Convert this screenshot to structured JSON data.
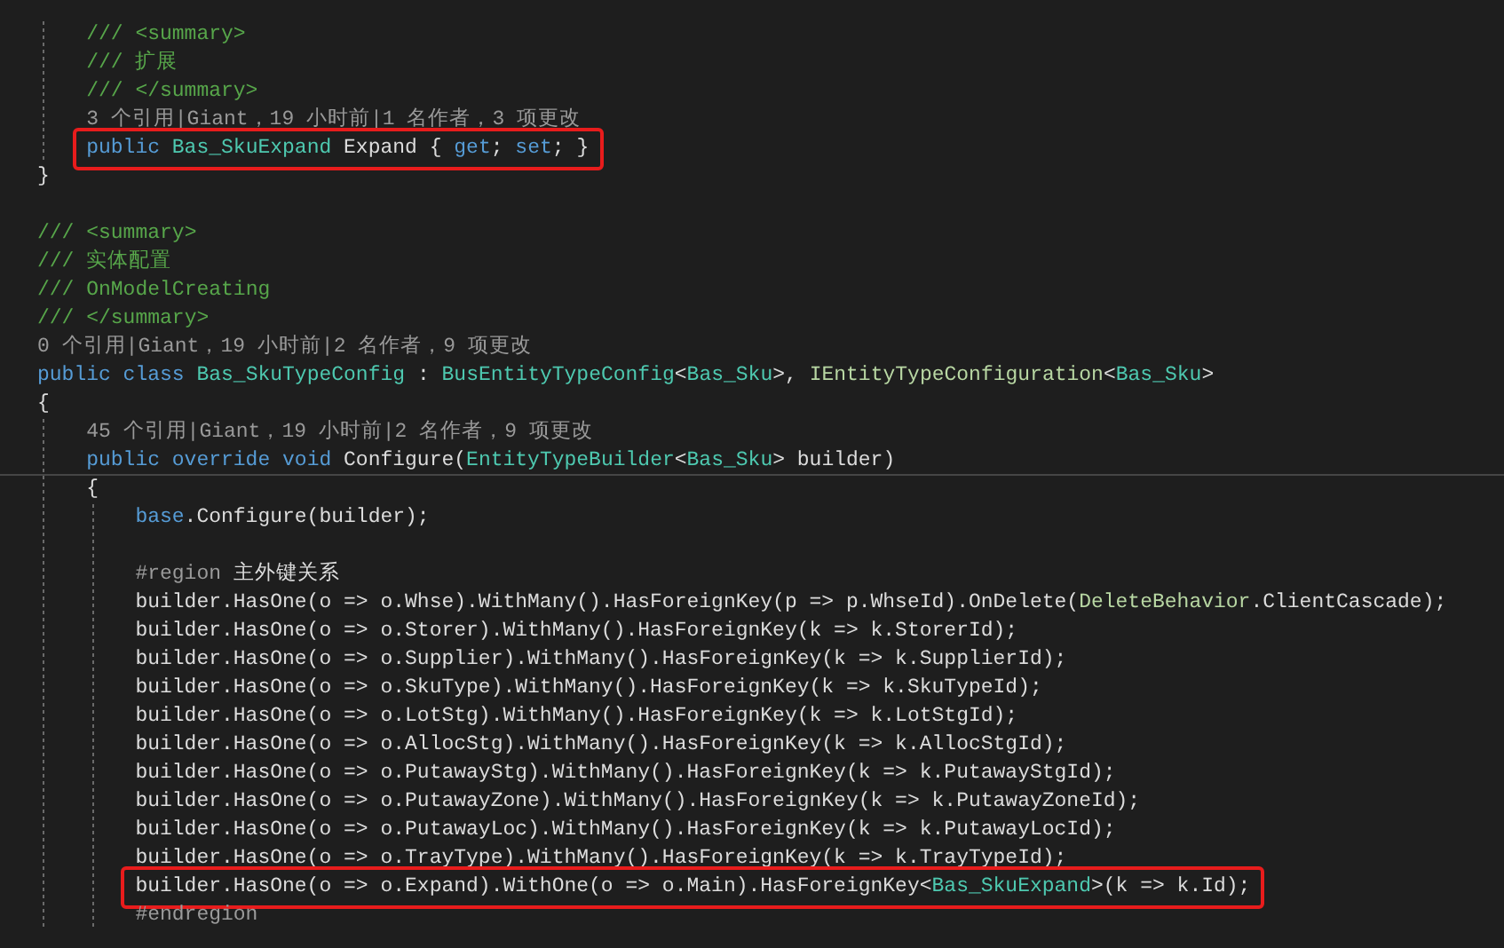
{
  "editor": {
    "lines": [
      {
        "kind": "comment",
        "tokens": [
          {
            "kind": "comment",
            "text": "    /// <summary>"
          }
        ]
      },
      {
        "kind": "comment",
        "tokens": [
          {
            "kind": "comment",
            "text": "    /// 扩展"
          }
        ]
      },
      {
        "kind": "comment",
        "tokens": [
          {
            "kind": "comment",
            "text": "    /// </summary>"
          }
        ]
      },
      {
        "kind": "codelens",
        "tokens": [
          {
            "kind": "codelens",
            "text": "    3 个引用|Giant，19 小时前|1 名作者，3 项更改"
          }
        ]
      },
      {
        "kind": "code",
        "highlighted": true,
        "tokens": [
          {
            "kind": "keyword",
            "text": "    public "
          },
          {
            "kind": "type",
            "text": "Bas_SkuExpand"
          },
          {
            "kind": "plain",
            "text": " Expand { "
          },
          {
            "kind": "keyword",
            "text": "get"
          },
          {
            "kind": "plain",
            "text": "; "
          },
          {
            "kind": "keyword",
            "text": "set"
          },
          {
            "kind": "plain",
            "text": "; }"
          }
        ]
      },
      {
        "kind": "code",
        "tokens": [
          {
            "kind": "plain",
            "text": "}"
          }
        ]
      },
      {
        "kind": "blank"
      },
      {
        "kind": "comment",
        "tokens": [
          {
            "kind": "comment",
            "text": "/// <summary>"
          }
        ]
      },
      {
        "kind": "comment",
        "tokens": [
          {
            "kind": "comment",
            "text": "/// 实体配置"
          }
        ]
      },
      {
        "kind": "comment",
        "tokens": [
          {
            "kind": "comment",
            "text": "/// OnModelCreating"
          }
        ]
      },
      {
        "kind": "comment",
        "tokens": [
          {
            "kind": "comment",
            "text": "/// </summary>"
          }
        ]
      },
      {
        "kind": "codelens",
        "tokens": [
          {
            "kind": "codelens",
            "text": "0 个引用|Giant，19 小时前|2 名作者，9 项更改"
          }
        ]
      },
      {
        "kind": "code",
        "tokens": [
          {
            "kind": "keyword",
            "text": "public class "
          },
          {
            "kind": "type",
            "text": "Bas_SkuTypeConfig"
          },
          {
            "kind": "plain",
            "text": " : "
          },
          {
            "kind": "type",
            "text": "BusEntityTypeConfig"
          },
          {
            "kind": "plain",
            "text": "<"
          },
          {
            "kind": "type",
            "text": "Bas_Sku"
          },
          {
            "kind": "plain",
            "text": ">, "
          },
          {
            "kind": "interface",
            "text": "IEntityTypeConfiguration"
          },
          {
            "kind": "plain",
            "text": "<"
          },
          {
            "kind": "type",
            "text": "Bas_Sku"
          },
          {
            "kind": "plain",
            "text": ">"
          }
        ]
      },
      {
        "kind": "code",
        "tokens": [
          {
            "kind": "plain",
            "text": "{"
          }
        ]
      },
      {
        "kind": "codelens",
        "tokens": [
          {
            "kind": "codelens",
            "text": "    45 个引用|Giant，19 小时前|2 名作者，9 项更改"
          }
        ]
      },
      {
        "kind": "code",
        "current": true,
        "tokens": [
          {
            "kind": "keyword",
            "text": "    public override void"
          },
          {
            "kind": "plain",
            "text": " Configure("
          },
          {
            "kind": "type",
            "text": "EntityTypeBuilder"
          },
          {
            "kind": "plain",
            "text": "<"
          },
          {
            "kind": "type",
            "text": "Bas_Sku"
          },
          {
            "kind": "plain",
            "text": "> builder)"
          }
        ]
      },
      {
        "kind": "code",
        "tokens": [
          {
            "kind": "plain",
            "text": "    {"
          }
        ]
      },
      {
        "kind": "code",
        "tokens": [
          {
            "kind": "keyword",
            "text": "        base"
          },
          {
            "kind": "plain",
            "text": ".Configure(builder);"
          }
        ]
      },
      {
        "kind": "blank"
      },
      {
        "kind": "code",
        "tokens": [
          {
            "kind": "directive",
            "text": "        #region"
          },
          {
            "kind": "plain",
            "text": " 主外键关系"
          }
        ]
      },
      {
        "kind": "code",
        "tokens": [
          {
            "kind": "plain",
            "text": "        builder.HasOne(o => o.Whse).WithMany().HasForeignKey(p => p.WhseId).OnDelete("
          },
          {
            "kind": "interface",
            "text": "DeleteBehavior"
          },
          {
            "kind": "plain",
            "text": ".ClientCascade);"
          }
        ]
      },
      {
        "kind": "code",
        "tokens": [
          {
            "kind": "plain",
            "text": "        builder.HasOne(o => o.Storer).WithMany().HasForeignKey(k => k.StorerId);"
          }
        ]
      },
      {
        "kind": "code",
        "tokens": [
          {
            "kind": "plain",
            "text": "        builder.HasOne(o => o.Supplier).WithMany().HasForeignKey(k => k.SupplierId);"
          }
        ]
      },
      {
        "kind": "code",
        "tokens": [
          {
            "kind": "plain",
            "text": "        builder.HasOne(o => o.SkuType).WithMany().HasForeignKey(k => k.SkuTypeId);"
          }
        ]
      },
      {
        "kind": "code",
        "tokens": [
          {
            "kind": "plain",
            "text": "        builder.HasOne(o => o.LotStg).WithMany().HasForeignKey(k => k.LotStgId);"
          }
        ]
      },
      {
        "kind": "code",
        "tokens": [
          {
            "kind": "plain",
            "text": "        builder.HasOne(o => o.AllocStg).WithMany().HasForeignKey(k => k.AllocStgId);"
          }
        ]
      },
      {
        "kind": "code",
        "tokens": [
          {
            "kind": "plain",
            "text": "        builder.HasOne(o => o.PutawayStg).WithMany().HasForeignKey(k => k.PutawayStgId);"
          }
        ]
      },
      {
        "kind": "code",
        "tokens": [
          {
            "kind": "plain",
            "text": "        builder.HasOne(o => o.PutawayZone).WithMany().HasForeignKey(k => k.PutawayZoneId);"
          }
        ]
      },
      {
        "kind": "code",
        "tokens": [
          {
            "kind": "plain",
            "text": "        builder.HasOne(o => o.PutawayLoc).WithMany().HasForeignKey(k => k.PutawayLocId);"
          }
        ]
      },
      {
        "kind": "code",
        "tokens": [
          {
            "kind": "plain",
            "text": "        builder.HasOne(o => o.TrayType).WithMany().HasForeignKey(k => k.TrayTypeId);"
          }
        ]
      },
      {
        "kind": "code",
        "highlighted": true,
        "tokens": [
          {
            "kind": "plain",
            "text": "        builder.HasOne(o => o.Expand).WithOne(o => o.Main).HasForeignKey<"
          },
          {
            "kind": "type",
            "text": "Bas_SkuExpand"
          },
          {
            "kind": "plain",
            "text": ">(k => k.Id);"
          }
        ]
      },
      {
        "kind": "code",
        "tokens": [
          {
            "kind": "directive",
            "text": "        #endregion"
          }
        ]
      }
    ]
  }
}
